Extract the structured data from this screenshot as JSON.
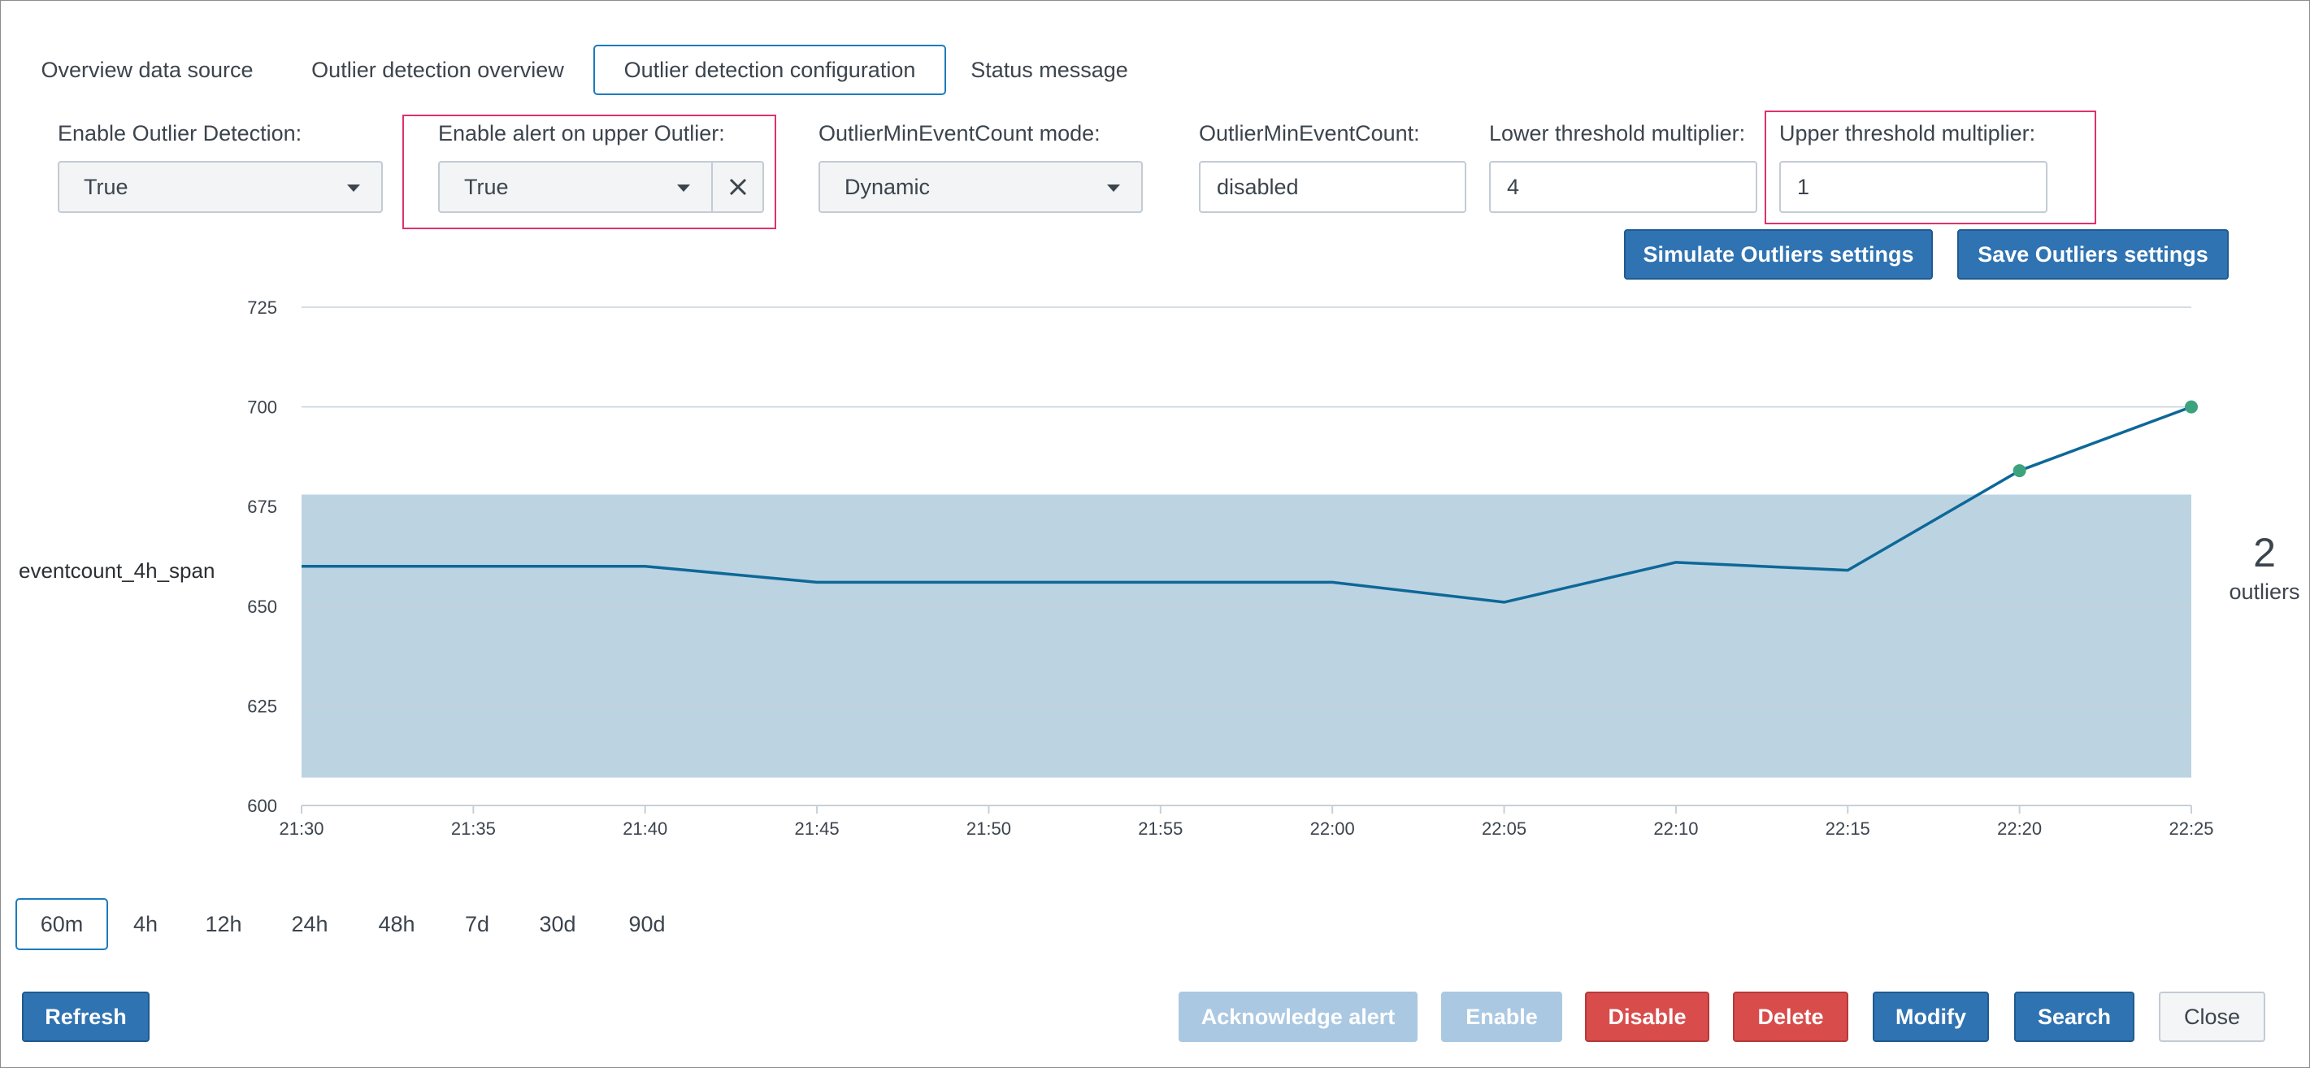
{
  "tabs": [
    {
      "label": "Overview data source",
      "active": false
    },
    {
      "label": "Outlier detection overview",
      "active": false
    },
    {
      "label": "Outlier detection configuration",
      "active": true
    },
    {
      "label": "Status message",
      "active": false
    }
  ],
  "form": {
    "enable_outlier": {
      "label": "Enable Outlier Detection:",
      "value": "True"
    },
    "enable_alert_upper": {
      "label": "Enable alert on upper Outlier:",
      "value": "True"
    },
    "min_event_count_mode": {
      "label": "OutlierMinEventCount mode:",
      "value": "Dynamic"
    },
    "min_event_count": {
      "label": "OutlierMinEventCount:",
      "value": "disabled"
    },
    "lower_threshold": {
      "label": "Lower threshold multiplier:",
      "value": "4"
    },
    "upper_threshold": {
      "label": "Upper threshold multiplier:",
      "value": "1"
    }
  },
  "actions": {
    "simulate": "Simulate Outliers settings",
    "save": "Save Outliers settings"
  },
  "colors": {
    "accent": "#2f73b2",
    "highlight": "#e1306c",
    "band": "#bcd3e2",
    "line": "#0d6898",
    "outlier_point": "#3ca37e",
    "danger": "#d94c4c"
  },
  "chart_data": {
    "type": "line",
    "ylabel": "eventcount_4h_span",
    "x": [
      "21:30",
      "21:35",
      "21:40",
      "21:45",
      "21:50",
      "21:55",
      "22:00",
      "22:05",
      "22:10",
      "22:15",
      "22:20",
      "22:25"
    ],
    "series": [
      {
        "values": [
          660,
          660,
          660,
          656,
          656,
          656,
          656,
          651,
          661,
          659,
          684,
          700
        ]
      }
    ],
    "band": {
      "lower": 607,
      "upper": 678
    },
    "outlier_indices": [
      10,
      11
    ],
    "ylim": [
      600,
      725
    ],
    "yticks": [
      600,
      625,
      650,
      675,
      700,
      725
    ],
    "grid": true
  },
  "outliers_summary": {
    "count": "2",
    "label": "outliers"
  },
  "time_ranges": [
    {
      "label": "60m",
      "active": true
    },
    {
      "label": "4h",
      "active": false
    },
    {
      "label": "12h",
      "active": false
    },
    {
      "label": "24h",
      "active": false
    },
    {
      "label": "48h",
      "active": false
    },
    {
      "label": "7d",
      "active": false
    },
    {
      "label": "30d",
      "active": false
    },
    {
      "label": "90d",
      "active": false
    }
  ],
  "footer": {
    "refresh": "Refresh",
    "acknowledge": "Acknowledge alert",
    "enable": "Enable",
    "disable": "Disable",
    "delete": "Delete",
    "modify": "Modify",
    "search": "Search",
    "close": "Close"
  }
}
